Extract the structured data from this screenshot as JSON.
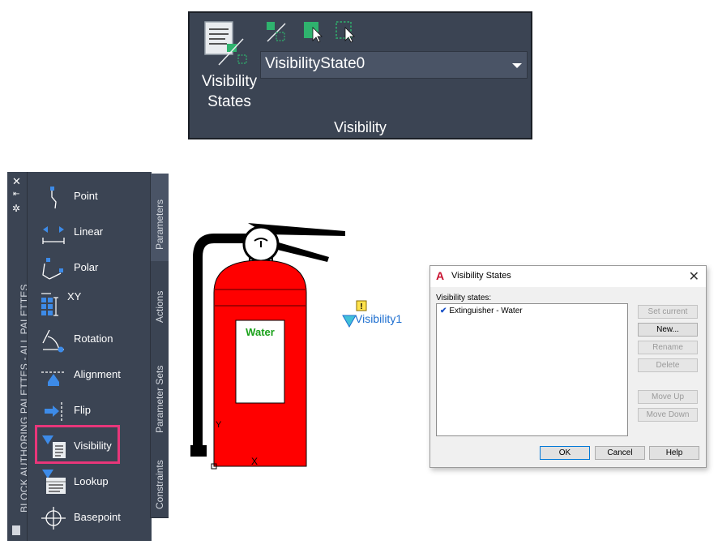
{
  "ribbon": {
    "big_button_label_line1": "Visibility",
    "big_button_label_line2": "States",
    "dropdown_value": "VisibilityState0",
    "panel_title": "Visibility",
    "small_icons": [
      "make-visible-icon",
      "make-invisible-icon",
      "select-icon"
    ]
  },
  "palette": {
    "title": "BLOCK AUTHORING PALETTES - ALL PALETTES",
    "items": [
      {
        "label": "Point",
        "icon": "point-parameter-icon"
      },
      {
        "label": "Linear",
        "icon": "linear-parameter-icon"
      },
      {
        "label": "Polar",
        "icon": "polar-parameter-icon"
      },
      {
        "label": "XY",
        "icon": "xy-parameter-icon"
      },
      {
        "label": "Rotation",
        "icon": "rotation-parameter-icon"
      },
      {
        "label": "Alignment",
        "icon": "alignment-parameter-icon"
      },
      {
        "label": "Flip",
        "icon": "flip-parameter-icon"
      },
      {
        "label": "Visibility",
        "icon": "visibility-parameter-icon"
      },
      {
        "label": "Lookup",
        "icon": "lookup-parameter-icon"
      },
      {
        "label": "Basepoint",
        "icon": "basepoint-parameter-icon"
      }
    ],
    "tabs": [
      "Parameters",
      "Actions",
      "Parameter Sets",
      "Constraints"
    ]
  },
  "drawing": {
    "extinguisher_label": "Water",
    "parameter_label": "Visibility1",
    "axis_y": "Y",
    "axis_x": "X",
    "warning_glyph": "!",
    "colors": {
      "body": "#ff0000",
      "label_text": "#1aa11a",
      "parameter": "#1e6fd0"
    }
  },
  "dialog": {
    "title": "Visibility States",
    "close_glyph": "✕",
    "list_label": "Visibility states:",
    "list_items": [
      "Extinguisher - Water"
    ],
    "check_glyph": "✔",
    "buttons": {
      "set_current": "Set current",
      "new": "New...",
      "rename": "Rename",
      "delete": "Delete",
      "move_up": "Move Up",
      "move_down": "Move Down",
      "ok": "OK",
      "cancel": "Cancel",
      "help": "Help"
    }
  },
  "colors": {
    "ribbon_bg": "#3b4453",
    "highlight": "#e8367a",
    "autocad_red": "#c8102e"
  }
}
